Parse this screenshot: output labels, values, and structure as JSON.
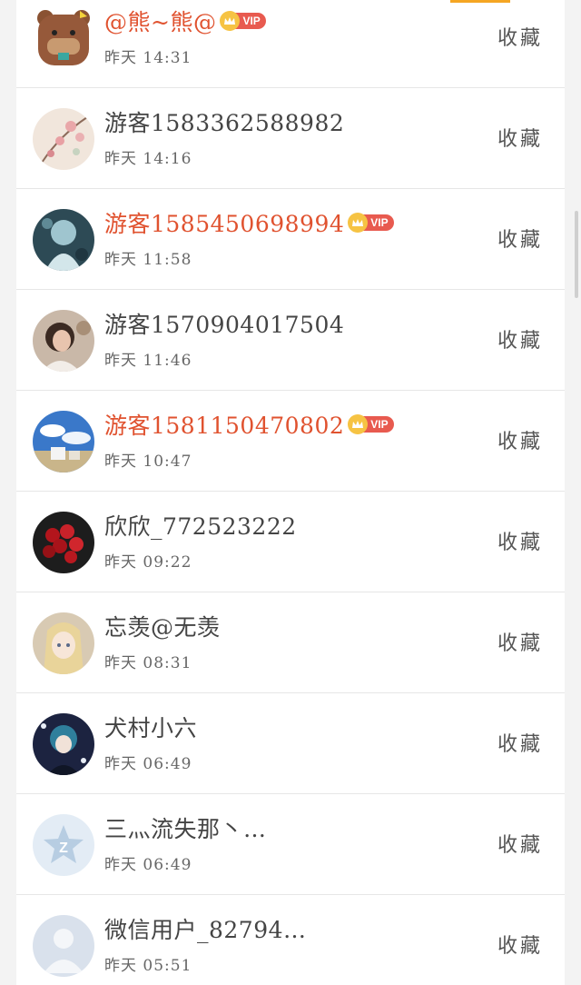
{
  "items": [
    {
      "name": "@熊~熊@",
      "vip": true,
      "vip_label": "VIP",
      "time": "昨天 14:31",
      "action": "收藏"
    },
    {
      "name": "游客1583362588982",
      "vip": false,
      "vip_label": "",
      "time": "昨天 14:16",
      "action": "收藏"
    },
    {
      "name": "游客1585450698994",
      "vip": true,
      "vip_label": "VIP",
      "time": "昨天 11:58",
      "action": "收藏"
    },
    {
      "name": "游客1570904017504",
      "vip": false,
      "vip_label": "",
      "time": "昨天 11:46",
      "action": "收藏"
    },
    {
      "name": "游客1581150470802",
      "vip": true,
      "vip_label": "VIP",
      "time": "昨天 10:47",
      "action": "收藏"
    },
    {
      "name": "欣欣_772523222",
      "vip": false,
      "vip_label": "",
      "time": "昨天 09:22",
      "action": "收藏"
    },
    {
      "name": "忘羡@无羡",
      "vip": false,
      "vip_label": "",
      "time": "昨天 08:31",
      "action": "收藏"
    },
    {
      "name": "犬村小六",
      "vip": false,
      "vip_label": "",
      "time": "昨天 06:49",
      "action": "收藏"
    },
    {
      "name": "三灬流失那丶…",
      "vip": false,
      "vip_label": "",
      "time": "昨天 06:49",
      "action": "收藏"
    },
    {
      "name": "微信用户_82794…",
      "vip": false,
      "vip_label": "",
      "time": "昨天 05:51",
      "action": "收藏"
    }
  ],
  "colors": {
    "vip_name": "#e0522f",
    "vip_tag": "#e85a4f",
    "crown": "#f6c343",
    "accent": "#f5a623"
  }
}
